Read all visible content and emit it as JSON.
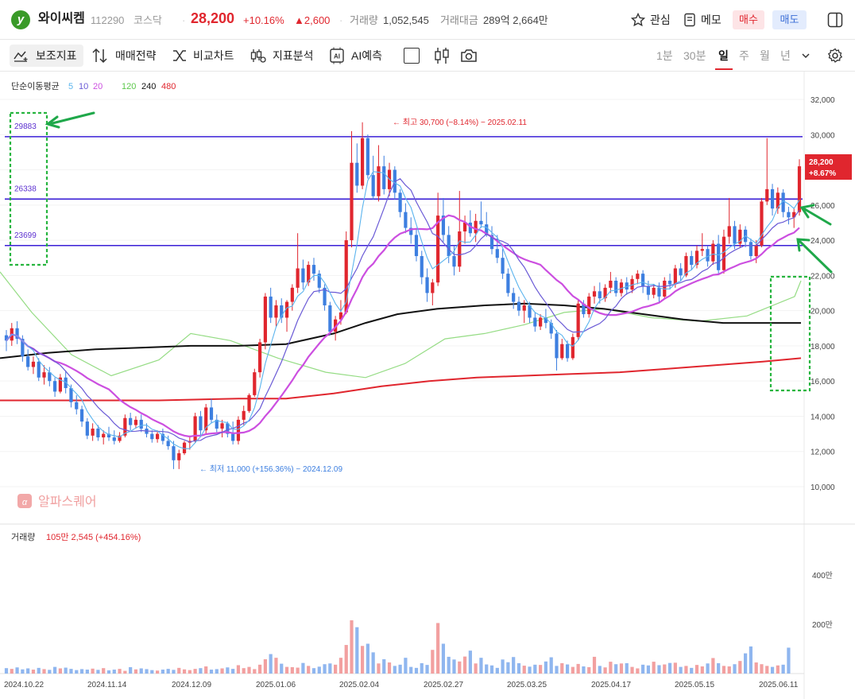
{
  "header": {
    "stock_name": "와이씨켐",
    "code": "112290",
    "market": "코스닥",
    "price": "28,200",
    "change_pct": "+10.16%",
    "change_abs": "▲2,600",
    "volume_label": "거래량",
    "volume": "1,052,545",
    "value_label": "거래대금",
    "value": "289억 2,664만",
    "watch_label": "관심",
    "memo_label": "메모",
    "buy_label": "매수",
    "sell_label": "매도"
  },
  "toolbar": {
    "indicators": "보조지표",
    "strategy": "매매전략",
    "compare": "비교차트",
    "analysis": "지표분석",
    "ai": "AI예측",
    "periods": [
      "1분",
      "30분",
      "일",
      "주",
      "월",
      "년"
    ],
    "active_period": "일"
  },
  "ma_legend": {
    "label": "단순이동평균",
    "periods": [
      {
        "v": "5",
        "color": "#5bb4ee"
      },
      {
        "v": "10",
        "color": "#6a5ad6"
      },
      {
        "v": "20",
        "color": "#cc4fe0"
      },
      {
        "v": "120",
        "color": "#8fd87b"
      },
      {
        "v": "240",
        "color": "#111111"
      },
      {
        "v": "480",
        "color": "#e0262e"
      }
    ]
  },
  "watermark": "알파스퀘어",
  "volume_legend": {
    "label": "거래량",
    "value": "105만 2,545 (+454.16%)"
  },
  "annotations": {
    "high": "← 최고 30,700 (−8.14%) − 2025.02.11",
    "low": "← 최저 11,000 (+156.36%) − 2024.12.09"
  },
  "last_price_tag": {
    "price": "28,200",
    "pct": "+8.67%"
  },
  "colors": {
    "up": "#e0262e",
    "down": "#3d7fe0",
    "level": "#3a1fd6",
    "arrow": "#1fa84a",
    "box": "#27b53f"
  },
  "chart_data": {
    "type": "candlestick",
    "price_axis": {
      "ticks": [
        "32,000",
        "30,000",
        "28,000",
        "26,000",
        "24,000",
        "22,000",
        "20,000",
        "18,000",
        "16,000",
        "14,000",
        "12,000",
        "10,000"
      ],
      "range": [
        9000,
        33000
      ]
    },
    "volume_axis": {
      "ticks": [
        "400만",
        "200만"
      ],
      "max_man": 620
    },
    "x_labels": [
      "2024.10.22",
      "2024.11.14",
      "2024.12.09",
      "2025.01.06",
      "2025.02.04",
      "2025.02.27",
      "2025.03.25",
      "2025.04.17",
      "2025.05.15",
      "2025.06.11"
    ],
    "levels": [
      {
        "value": 29883,
        "label": "29883"
      },
      {
        "value": 26338,
        "label": "26338"
      },
      {
        "value": 23699,
        "label": "23699"
      }
    ],
    "ohlc": [
      [
        18600,
        18900,
        17700,
        18300
      ],
      [
        18300,
        19300,
        18000,
        19000
      ],
      [
        19000,
        19400,
        18100,
        18400
      ],
      [
        18400,
        18600,
        17100,
        17400
      ],
      [
        17400,
        17800,
        16600,
        16800
      ],
      [
        16800,
        17400,
        16400,
        17100
      ],
      [
        17100,
        17300,
        16000,
        16200
      ],
      [
        16200,
        16900,
        15800,
        16500
      ],
      [
        16500,
        16800,
        15700,
        16000
      ],
      [
        16000,
        16200,
        15100,
        15400
      ],
      [
        15400,
        16400,
        15300,
        16200
      ],
      [
        16200,
        16600,
        15300,
        15600
      ],
      [
        15600,
        15800,
        14500,
        14800
      ],
      [
        14800,
        15200,
        14100,
        14400
      ],
      [
        14400,
        14600,
        13400,
        13700
      ],
      [
        13700,
        13900,
        12700,
        12900
      ],
      [
        12900,
        13600,
        12600,
        13300
      ],
      [
        13300,
        13500,
        12600,
        12800
      ],
      [
        12800,
        13200,
        12400,
        13000
      ],
      [
        13000,
        13400,
        12600,
        12800
      ],
      [
        12800,
        13200,
        12400,
        12600
      ],
      [
        12600,
        13100,
        12500,
        12900
      ],
      [
        12900,
        14100,
        12800,
        13900
      ],
      [
        13900,
        14200,
        13200,
        13500
      ],
      [
        13500,
        14000,
        13300,
        13800
      ],
      [
        13800,
        14100,
        13100,
        13300
      ],
      [
        13300,
        13600,
        12800,
        13000
      ],
      [
        13000,
        13200,
        12500,
        12700
      ],
      [
        12700,
        13200,
        12500,
        13000
      ],
      [
        13000,
        13300,
        12400,
        12600
      ],
      [
        12600,
        12900,
        12100,
        12300
      ],
      [
        12300,
        12600,
        11000,
        11500
      ],
      [
        11500,
        12100,
        11000,
        11900
      ],
      [
        11900,
        12600,
        11800,
        12500
      ],
      [
        12500,
        12900,
        12100,
        12600
      ],
      [
        12600,
        14200,
        12500,
        14000
      ],
      [
        14000,
        14300,
        12900,
        13200
      ],
      [
        13200,
        14700,
        13000,
        14500
      ],
      [
        14500,
        15000,
        13600,
        13800
      ],
      [
        13800,
        14100,
        13100,
        13300
      ],
      [
        13300,
        13800,
        12800,
        13600
      ],
      [
        13600,
        13700,
        12800,
        13000
      ],
      [
        13000,
        13700,
        12400,
        12600
      ],
      [
        12600,
        14000,
        12400,
        13800
      ],
      [
        13800,
        14600,
        13500,
        14300
      ],
      [
        14300,
        15300,
        14200,
        15200
      ],
      [
        15200,
        16700,
        15100,
        16500
      ],
      [
        16500,
        18400,
        16200,
        18200
      ],
      [
        18200,
        21000,
        17800,
        20800
      ],
      [
        20800,
        21300,
        19300,
        19600
      ],
      [
        19600,
        20600,
        19100,
        20300
      ],
      [
        20300,
        20700,
        19300,
        19600
      ],
      [
        19600,
        20600,
        18800,
        20500
      ],
      [
        20500,
        21500,
        20000,
        21300
      ],
      [
        21300,
        24400,
        21000,
        22400
      ],
      [
        22400,
        22900,
        21200,
        21600
      ],
      [
        21600,
        22800,
        21400,
        22600
      ],
      [
        22600,
        23000,
        21700,
        22100
      ],
      [
        22100,
        22300,
        21000,
        21300
      ],
      [
        21300,
        21500,
        20000,
        20300
      ],
      [
        20300,
        20500,
        18600,
        18800
      ],
      [
        18800,
        19700,
        18300,
        19500
      ],
      [
        19500,
        20600,
        19200,
        19900
      ],
      [
        19900,
        24500,
        19800,
        24000
      ],
      [
        24000,
        30200,
        23600,
        28400
      ],
      [
        28400,
        29500,
        26700,
        27100
      ],
      [
        27100,
        30700,
        26900,
        29800
      ],
      [
        29800,
        30000,
        27500,
        27700
      ],
      [
        27700,
        28800,
        26300,
        26500
      ],
      [
        26500,
        29400,
        26200,
        28200
      ],
      [
        28200,
        28800,
        26600,
        26900
      ],
      [
        26900,
        28400,
        26500,
        28000
      ],
      [
        28000,
        28200,
        26300,
        26700
      ],
      [
        26700,
        26900,
        25300,
        25600
      ],
      [
        25600,
        26100,
        24400,
        24700
      ],
      [
        24700,
        25300,
        23800,
        24300
      ],
      [
        24300,
        24700,
        22800,
        23100
      ],
      [
        23100,
        23400,
        21500,
        21900
      ],
      [
        21900,
        22400,
        20500,
        21000
      ],
      [
        21000,
        21800,
        20300,
        21600
      ],
      [
        21600,
        26700,
        21400,
        25400
      ],
      [
        25400,
        26400,
        23900,
        24300
      ],
      [
        24300,
        24800,
        22700,
        23100
      ],
      [
        23100,
        23700,
        22000,
        22500
      ],
      [
        22500,
        26800,
        22200,
        24500
      ],
      [
        24500,
        25400,
        23800,
        25000
      ],
      [
        25000,
        25700,
        24200,
        24400
      ],
      [
        24400,
        25500,
        23900,
        25100
      ],
      [
        25100,
        26200,
        24700,
        24900
      ],
      [
        24900,
        25600,
        24200,
        24300
      ],
      [
        24300,
        24800,
        23200,
        23500
      ],
      [
        23500,
        24300,
        22700,
        23000
      ],
      [
        23000,
        23500,
        21800,
        22100
      ],
      [
        22100,
        22400,
        20800,
        21000
      ],
      [
        21000,
        21300,
        20100,
        20500
      ],
      [
        20500,
        20800,
        19700,
        20000
      ],
      [
        20000,
        20600,
        19300,
        20300
      ],
      [
        20300,
        20500,
        19300,
        19600
      ],
      [
        19600,
        19900,
        18800,
        19100
      ],
      [
        19100,
        19800,
        18900,
        19600
      ],
      [
        19600,
        20100,
        19000,
        19300
      ],
      [
        19300,
        19500,
        18400,
        18700
      ],
      [
        18700,
        18900,
        16600,
        17300
      ],
      [
        17300,
        18400,
        17200,
        18100
      ],
      [
        18100,
        18300,
        17100,
        17300
      ],
      [
        17300,
        18700,
        17200,
        18500
      ],
      [
        18500,
        20600,
        18300,
        20400
      ],
      [
        20400,
        20600,
        19600,
        19800
      ],
      [
        19800,
        21000,
        19600,
        20800
      ],
      [
        20800,
        21400,
        20400,
        21100
      ],
      [
        21100,
        21600,
        20400,
        20700
      ],
      [
        20700,
        21500,
        20500,
        21300
      ],
      [
        21300,
        22200,
        21000,
        21700
      ],
      [
        21700,
        21900,
        20800,
        21000
      ],
      [
        21000,
        21800,
        20800,
        21600
      ],
      [
        21600,
        21900,
        20900,
        21200
      ],
      [
        21200,
        22000,
        21000,
        21800
      ],
      [
        21800,
        22300,
        21500,
        22100
      ],
      [
        22100,
        22300,
        21000,
        21400
      ],
      [
        21400,
        21700,
        20600,
        20900
      ],
      [
        20900,
        21500,
        20700,
        21300
      ],
      [
        21300,
        21600,
        20500,
        20800
      ],
      [
        20800,
        21900,
        20700,
        21700
      ],
      [
        21700,
        22100,
        21200,
        21500
      ],
      [
        21500,
        22600,
        21300,
        22400
      ],
      [
        22400,
        22700,
        21700,
        22000
      ],
      [
        22000,
        23300,
        21900,
        23100
      ],
      [
        23100,
        23400,
        22300,
        22600
      ],
      [
        22600,
        23700,
        22400,
        23400
      ],
      [
        23400,
        24400,
        23100,
        23500
      ],
      [
        23500,
        23700,
        22500,
        22800
      ],
      [
        22800,
        24000,
        22600,
        23800
      ],
      [
        23800,
        24300,
        22100,
        22300
      ],
      [
        22300,
        24600,
        22100,
        24200
      ],
      [
        24200,
        26400,
        23800,
        24800
      ],
      [
        24800,
        25100,
        23500,
        23800
      ],
      [
        23800,
        24900,
        23600,
        24600
      ],
      [
        24600,
        24800,
        23600,
        23900
      ],
      [
        23900,
        24100,
        22900,
        23100
      ],
      [
        23100,
        24000,
        22700,
        23700
      ],
      [
        23700,
        26400,
        23600,
        26200
      ],
      [
        26200,
        29800,
        26000,
        26900
      ],
      [
        26900,
        27200,
        25400,
        25800
      ],
      [
        25800,
        27000,
        25500,
        26700
      ],
      [
        26700,
        26900,
        25300,
        25600
      ],
      [
        25600,
        25900,
        24900,
        25300
      ],
      [
        25300,
        25800,
        24700,
        25600
      ],
      [
        25600,
        28600,
        25400,
        28200
      ]
    ],
    "volume_man": [
      22,
      19,
      25,
      17,
      21,
      16,
      23,
      18,
      15,
      27,
      21,
      24,
      19,
      14,
      18,
      16,
      20,
      15,
      22,
      13,
      16,
      19,
      11,
      26,
      17,
      21,
      18,
      14,
      12,
      16,
      19,
      15,
      23,
      17,
      14,
      19,
      22,
      29,
      16,
      18,
      21,
      25,
      19,
      34,
      22,
      27,
      18,
      36,
      58,
      79,
      64,
      40,
      27,
      26,
      24,
      43,
      31,
      22,
      28,
      38,
      41,
      36,
      64,
      116,
      216,
      188,
      112,
      121,
      86,
      41,
      58,
      45,
      31,
      36,
      64,
      27,
      23,
      42,
      35,
      96,
      205,
      121,
      68,
      57,
      49,
      69,
      93,
      41,
      64,
      37,
      33,
      23,
      57,
      46,
      67,
      42,
      32,
      28,
      36,
      35,
      49,
      66,
      31,
      42,
      37,
      27,
      39,
      29,
      26,
      68,
      31,
      25,
      48,
      38,
      41,
      42,
      27,
      21,
      36,
      33,
      48,
      34,
      37,
      43,
      44,
      27,
      31,
      23,
      35,
      29,
      41,
      63,
      42,
      31,
      29,
      38,
      51,
      82,
      110,
      45,
      38,
      31,
      27,
      33,
      36,
      105
    ],
    "ma5_start": 0,
    "ma_series": {
      "ma120": [
        [
          0,
          22200
        ],
        [
          40,
          19900
        ],
        [
          90,
          17500
        ],
        [
          140,
          16300
        ],
        [
          200,
          17200
        ],
        [
          240,
          18700
        ],
        [
          290,
          18300
        ],
        [
          350,
          17300
        ],
        [
          410,
          16500
        ],
        [
          460,
          16200
        ],
        [
          510,
          17000
        ],
        [
          560,
          18400
        ],
        [
          610,
          18700
        ],
        [
          660,
          19200
        ],
        [
          710,
          19900
        ],
        [
          760,
          20100
        ],
        [
          820,
          19600
        ],
        [
          880,
          19400
        ],
        [
          940,
          19700
        ],
        [
          1000,
          20800
        ],
        [
          1008,
          21700
        ]
      ],
      "ma240": [
        [
          0,
          17300
        ],
        [
          60,
          17600
        ],
        [
          120,
          17800
        ],
        [
          180,
          17900
        ],
        [
          240,
          18000
        ],
        [
          300,
          18000
        ],
        [
          360,
          18100
        ],
        [
          420,
          18700
        ],
        [
          460,
          19300
        ],
        [
          500,
          19800
        ],
        [
          550,
          20100
        ],
        [
          610,
          20300
        ],
        [
          660,
          20400
        ],
        [
          710,
          20300
        ],
        [
          760,
          20100
        ],
        [
          810,
          19800
        ],
        [
          860,
          19500
        ],
        [
          910,
          19300
        ],
        [
          960,
          19300
        ],
        [
          1008,
          19300
        ]
      ],
      "ma480": [
        [
          0,
          14900
        ],
        [
          100,
          14900
        ],
        [
          200,
          14900
        ],
        [
          300,
          15000
        ],
        [
          360,
          15000
        ],
        [
          420,
          15300
        ],
        [
          480,
          15700
        ],
        [
          540,
          16000
        ],
        [
          600,
          16200
        ],
        [
          660,
          16300
        ],
        [
          720,
          16400
        ],
        [
          780,
          16500
        ],
        [
          840,
          16700
        ],
        [
          900,
          16900
        ],
        [
          960,
          17100
        ],
        [
          1008,
          17300
        ]
      ]
    }
  }
}
